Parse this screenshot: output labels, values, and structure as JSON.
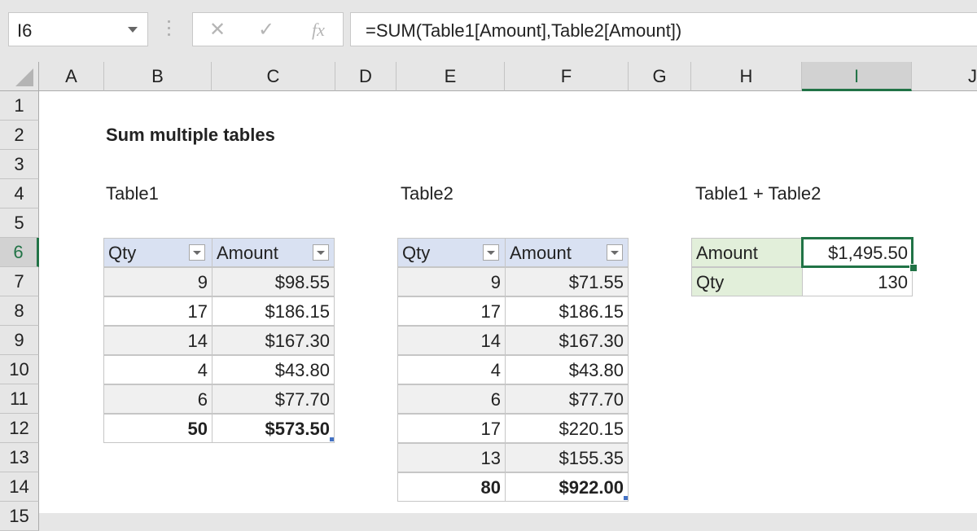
{
  "name_box": {
    "value": "I6"
  },
  "formula_bar": {
    "cancel_icon": "✕",
    "enter_icon": "✓",
    "fx_icon": "fx",
    "formula": "=SUM(Table1[Amount],Table2[Amount])"
  },
  "columns": [
    "A",
    "B",
    "C",
    "D",
    "E",
    "F",
    "G",
    "H",
    "I",
    "J"
  ],
  "rows": [
    "1",
    "2",
    "3",
    "4",
    "5",
    "6",
    "7",
    "8",
    "9",
    "10",
    "11",
    "12",
    "13",
    "14",
    "15"
  ],
  "selected": {
    "column": "I",
    "row": "6"
  },
  "title": "Sum multiple tables",
  "table1": {
    "label": "Table1",
    "headers": [
      "Qty",
      "Amount"
    ],
    "rows": [
      {
        "qty": "9",
        "amount": "$98.55"
      },
      {
        "qty": "17",
        "amount": "$186.15"
      },
      {
        "qty": "14",
        "amount": "$167.30"
      },
      {
        "qty": "4",
        "amount": "$43.80"
      },
      {
        "qty": "6",
        "amount": "$77.70"
      }
    ],
    "total": {
      "qty": "50",
      "amount": "$573.50"
    }
  },
  "table2": {
    "label": "Table2",
    "headers": [
      "Qty",
      "Amount"
    ],
    "rows": [
      {
        "qty": "9",
        "amount": "$71.55"
      },
      {
        "qty": "17",
        "amount": "$186.15"
      },
      {
        "qty": "14",
        "amount": "$167.30"
      },
      {
        "qty": "4",
        "amount": "$43.80"
      },
      {
        "qty": "6",
        "amount": "$77.70"
      },
      {
        "qty": "17",
        "amount": "$220.15"
      },
      {
        "qty": "13",
        "amount": "$155.35"
      }
    ],
    "total": {
      "qty": "80",
      "amount": "$922.00"
    }
  },
  "summary": {
    "label": "Table1 + Table2",
    "rows": [
      {
        "label": "Amount",
        "value": "$1,495.50"
      },
      {
        "label": "Qty",
        "value": "130"
      }
    ]
  },
  "colors": {
    "accent": "#217346",
    "table_header": "#d9e1f2",
    "summary_label": "#e2efda",
    "band": "#f0f0f0"
  }
}
